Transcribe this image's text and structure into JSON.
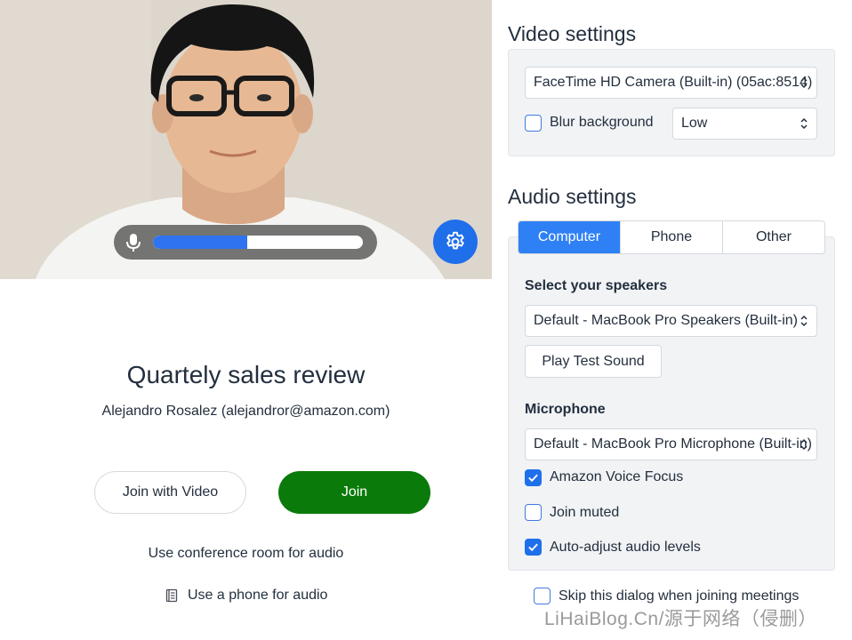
{
  "preview": {
    "mic_level": 0.45,
    "settings_icon": "gear-icon",
    "mic_icon": "microphone-icon"
  },
  "meeting": {
    "title": "Quartely sales review",
    "host": "Alejandro Rosalez (alejandror@amazon.com)"
  },
  "actions": {
    "join_with_video": "Join with Video",
    "join": "Join",
    "conference_room": "Use conference room for audio",
    "phone_audio": "Use a phone for audio"
  },
  "video_settings": {
    "title": "Video settings",
    "camera": "FaceTime HD Camera (Built-in) (05ac:8514)",
    "blur_label": "Blur background",
    "blur_checked": false,
    "blur_level": "Low"
  },
  "audio_settings": {
    "title": "Audio settings",
    "tabs": [
      {
        "label": "Computer",
        "active": true
      },
      {
        "label": "Phone",
        "active": false
      },
      {
        "label": "Other",
        "active": false
      }
    ],
    "speakers_label": "Select your speakers",
    "speakers_value": "Default - MacBook Pro Speakers (Built-in)",
    "test_sound": "Play Test Sound",
    "microphone_label": "Microphone",
    "microphone_value": "Default - MacBook Pro Microphone (Built-in)",
    "options": [
      {
        "label": "Amazon Voice Focus",
        "checked": true
      },
      {
        "label": "Join muted",
        "checked": false
      },
      {
        "label": "Auto-adjust audio levels",
        "checked": true
      }
    ]
  },
  "skip_dialog": {
    "label": "Skip this dialog when joining meetings",
    "checked": false
  },
  "watermark": "LiHaiBlog.Cn/源于网络（侵删）",
  "colors": {
    "accent": "#1f6feb",
    "join": "#0a7a0a",
    "panel": "#f1f3f5",
    "text": "#232f3e"
  }
}
